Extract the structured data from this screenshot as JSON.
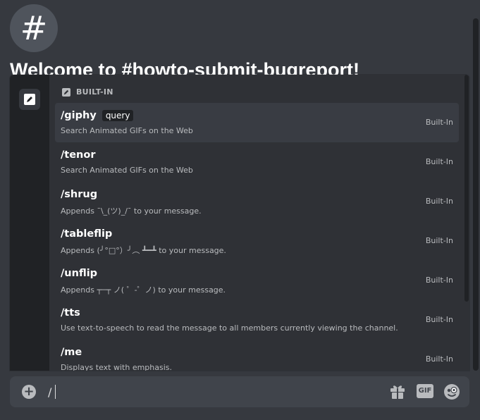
{
  "channel": {
    "hash_glyph": "#",
    "welcome_title": "Welcome to #howto-submit-bugreport!"
  },
  "autocomplete": {
    "section_label": "BUILT-IN",
    "commands": [
      {
        "name": "/giphy",
        "option": "query",
        "description": "Search Animated GIFs on the Web",
        "source": "Built-In",
        "selected": true
      },
      {
        "name": "/tenor",
        "option": "",
        "description": "Search Animated GIFs on the Web",
        "source": "Built-In",
        "selected": false
      },
      {
        "name": "/shrug",
        "option": "",
        "description": "Appends ¯\\_(ツ)_/¯ to your message.",
        "source": "Built-In",
        "selected": false
      },
      {
        "name": "/tableflip",
        "option": "",
        "description": "Appends (╯°□°）╯︵ ┻━┻ to your message.",
        "source": "Built-In",
        "selected": false
      },
      {
        "name": "/unflip",
        "option": "",
        "description": "Appends ┬─┬ ノ( ゜-゜ノ) to your message.",
        "source": "Built-In",
        "selected": false
      },
      {
        "name": "/tts",
        "option": "",
        "description": "Use text-to-speech to read the message to all members currently viewing the channel.",
        "source": "Built-In",
        "selected": false
      },
      {
        "name": "/me",
        "option": "",
        "description": "Displays text with emphasis.",
        "source": "Built-In",
        "selected": false
      }
    ]
  },
  "input": {
    "value": "/",
    "gif_label": "GIF"
  },
  "icons": {
    "rail": "pencil-icon",
    "section": "pencil-icon",
    "upload": "plus-circle-icon",
    "gift": "gift-icon",
    "gif": "gif-icon",
    "emoji": "emoji-icon"
  },
  "colors": {
    "background": "#36393f",
    "popup": "#2f3136",
    "rail": "#202225",
    "selected_row": "#393c43",
    "input_bar": "#40444b",
    "text_primary": "#ffffff",
    "text_muted": "#b9bbbe"
  }
}
